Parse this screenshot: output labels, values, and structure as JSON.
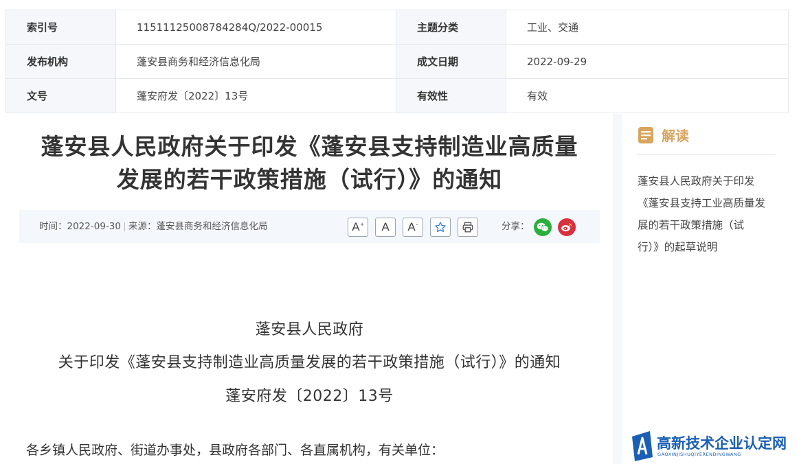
{
  "meta": {
    "rows": [
      {
        "label1": "索引号",
        "value1": "11511125008784284Q/2022-00015",
        "label2": "主题分类",
        "value2": "工业、交通"
      },
      {
        "label1": "发布机构",
        "value1": "蓬安县商务和经济信息化局",
        "label2": "成文日期",
        "value2": "2022-09-29"
      },
      {
        "label1": "文号",
        "value1": "蓬安府发〔2022〕13号",
        "label2": "有效性",
        "value2": "有效"
      }
    ]
  },
  "article": {
    "title_line1": "蓬安县人民政府关于印发《蓬安县支持制造业高质量",
    "title_line2": "发展的若干政策措施（试行）》的通知",
    "info": {
      "time_label": "时间：",
      "time": "2022-09-30",
      "source_label": "来源：",
      "source": "蓬安县商务和经济信息化局"
    },
    "toolbar": {
      "font_larger": "A",
      "font_larger_sup": "+",
      "font_normal": "A",
      "font_smaller": "A",
      "font_smaller_sup": "-",
      "share_label": "分享："
    },
    "doc_heading_1": "蓬安县人民政府",
    "doc_heading_2": "关于印发《蓬安县支持制造业高质量发展的若干政策措施（试行）》的通知",
    "doc_number": "蓬安府发〔2022〕13号",
    "salutation": "各乡镇人民政府、街道办事处，县政府各部门、各直属机构，有关单位："
  },
  "sidebar": {
    "title": "解读",
    "link_line1": "蓬安县人民政府关于印发",
    "link_line2": "《蓬安县支持工业高质量发",
    "link_line3": "展的若干政策措施（试",
    "link_line4": "行）》的起草说明"
  },
  "watermark": {
    "text": "高新技术企业认定网",
    "subtext": "GAOXINJISHUQIYERENDINGWANG"
  },
  "colors": {
    "accent_gold": "#d8a55f",
    "wechat_green": "#2aae3c",
    "weibo_red": "#d9303e",
    "star_blue": "#3a86d6",
    "brand_blue": "#1a5fb4"
  }
}
